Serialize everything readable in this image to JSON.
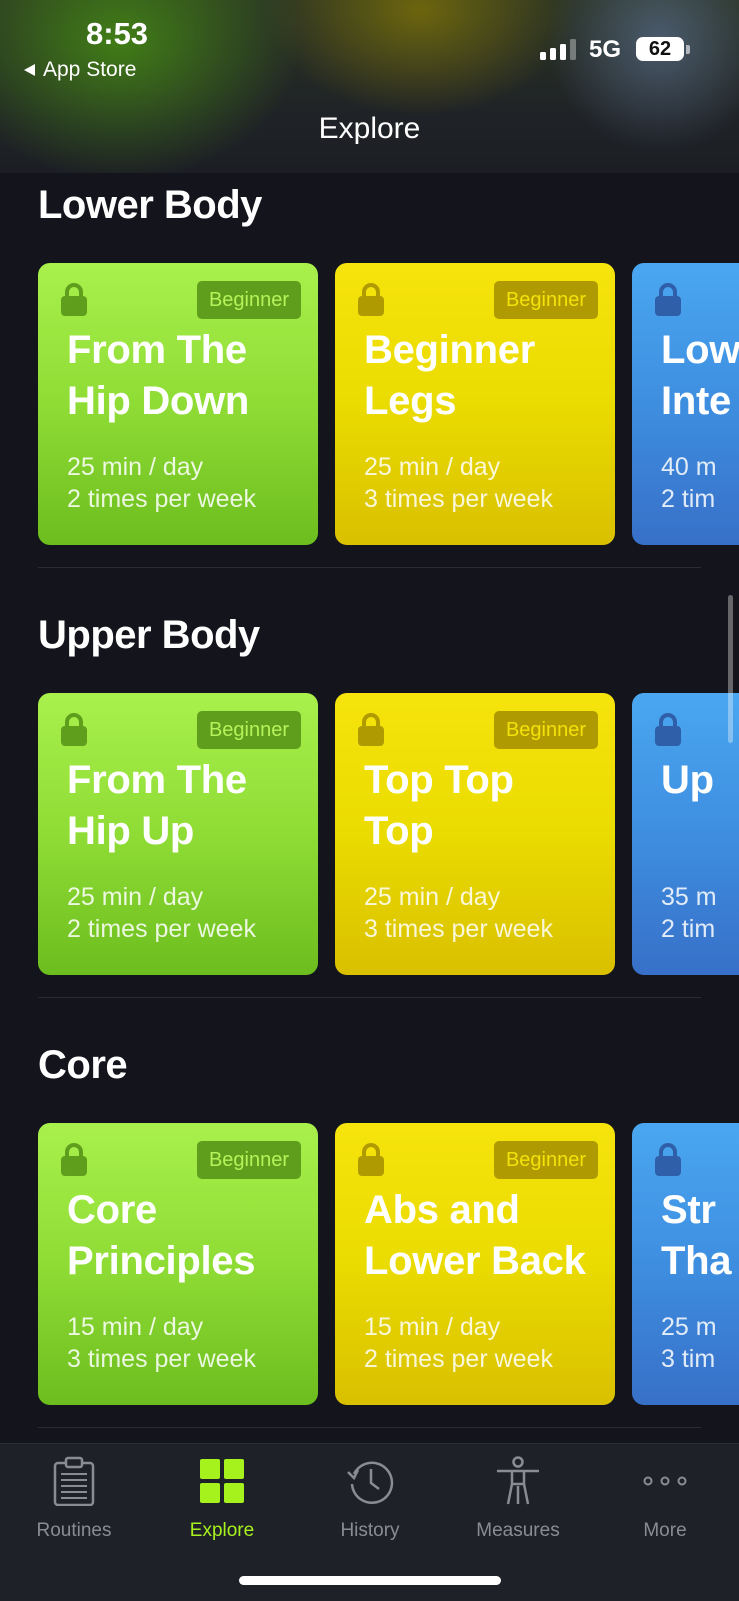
{
  "status_bar": {
    "time": "8:53",
    "back_app": "App Store",
    "network": "5G",
    "battery": "62"
  },
  "nav": {
    "title": "Explore"
  },
  "colors": {
    "accent": "#a6f21d",
    "green_card": "#8fdc35",
    "yellow_card": "#eadb00",
    "blue_card": "#3e8ee0",
    "background": "#14151c"
  },
  "sections": [
    {
      "title": "Lower Body",
      "cards": [
        {
          "badge": "Beginner",
          "title": "From The\nHip Down",
          "duration": "25 min / day",
          "frequency": "2 times per week"
        },
        {
          "badge": "Beginner",
          "title": "Beginner\nLegs",
          "duration": "25 min / day",
          "frequency": "3 times per week"
        },
        {
          "badge": "",
          "title": "Low\nInte",
          "duration": "40 m",
          "frequency": "2 tim"
        }
      ]
    },
    {
      "title": "Upper Body",
      "cards": [
        {
          "badge": "Beginner",
          "title": "From The\nHip Up",
          "duration": "25 min / day",
          "frequency": "2 times per week"
        },
        {
          "badge": "Beginner",
          "title": "Top Top\nTop",
          "duration": "25 min / day",
          "frequency": "3 times per week"
        },
        {
          "badge": "",
          "title": "Up",
          "duration": "35 m",
          "frequency": "2 tim"
        }
      ]
    },
    {
      "title": "Core",
      "cards": [
        {
          "badge": "Beginner",
          "title": "Core\nPrinciples",
          "duration": "15 min / day",
          "frequency": "3 times per week"
        },
        {
          "badge": "Beginner",
          "title": "Abs and\nLower Back",
          "duration": "15 min / day",
          "frequency": "2 times per week"
        },
        {
          "badge": "",
          "title": "Str\nTha",
          "duration": "25 m",
          "frequency": "3 tim"
        }
      ]
    }
  ],
  "tabs": [
    {
      "label": "Routines",
      "icon": "clipboard-icon",
      "active": false
    },
    {
      "label": "Explore",
      "icon": "grid-icon",
      "active": true
    },
    {
      "label": "History",
      "icon": "history-clock-icon",
      "active": false
    },
    {
      "label": "Measures",
      "icon": "body-figure-icon",
      "active": false
    },
    {
      "label": "More",
      "icon": "more-dots-icon",
      "active": false
    }
  ]
}
